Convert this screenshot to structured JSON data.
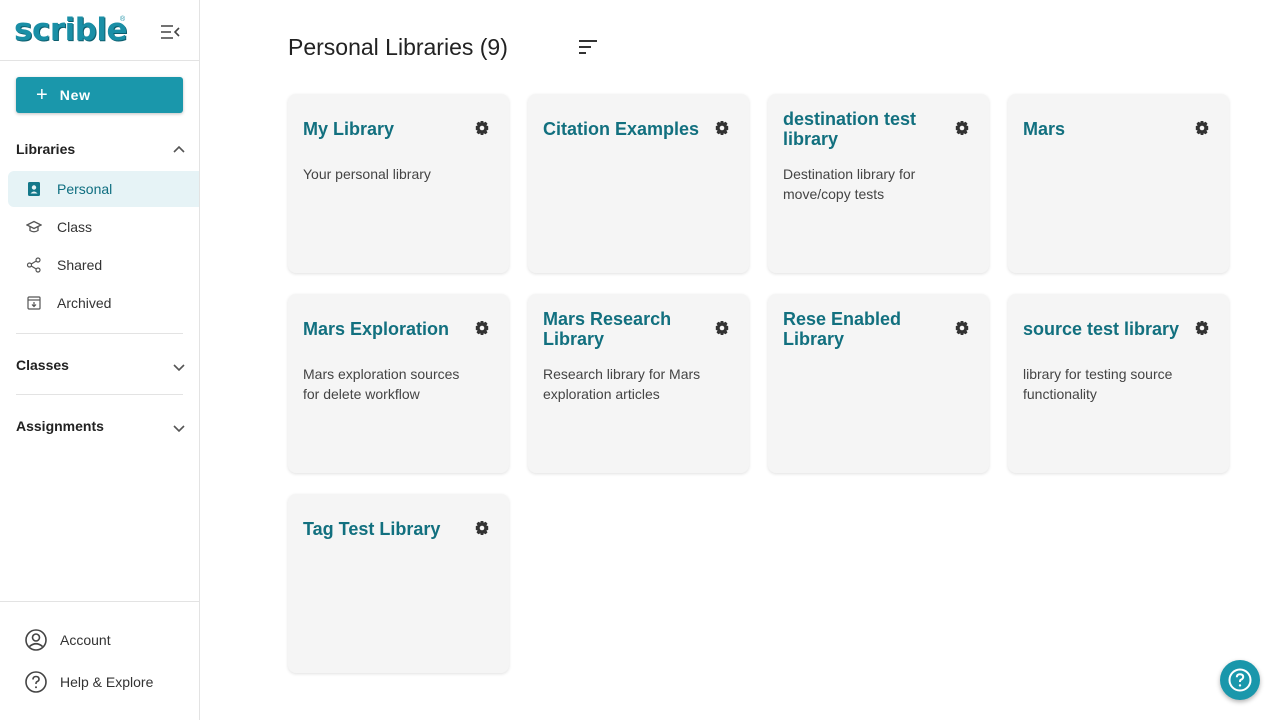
{
  "brand": {
    "name": "scrible",
    "reg": "®"
  },
  "sidebar": {
    "new_label": "New",
    "libraries_title": "Libraries",
    "nav": [
      {
        "label": "Personal",
        "icon": "contact-book-icon",
        "active": true
      },
      {
        "label": "Class",
        "icon": "graduation-cap-icon",
        "active": false
      },
      {
        "label": "Shared",
        "icon": "share-icon",
        "active": false
      },
      {
        "label": "Archived",
        "icon": "archive-icon",
        "active": false
      }
    ],
    "classes_title": "Classes",
    "assignments_title": "Assignments",
    "account_label": "Account",
    "help_label": "Help & Explore"
  },
  "main": {
    "title": "Personal Libraries (9)",
    "cards": [
      {
        "title": "My Library",
        "desc": "Your personal library"
      },
      {
        "title": "Citation Examples",
        "desc": ""
      },
      {
        "title": "destination test library",
        "desc": "Destination library for move/copy tests"
      },
      {
        "title": "Mars",
        "desc": ""
      },
      {
        "title": "Mars Exploration",
        "desc": "Mars exploration sources for delete workflow"
      },
      {
        "title": "Mars Research Library",
        "desc": "Research library for Mars exploration articles"
      },
      {
        "title": "Rese Enabled Library",
        "desc": ""
      },
      {
        "title": "source test library",
        "desc": "library for testing source functionality"
      },
      {
        "title": "Tag Test Library",
        "desc": ""
      }
    ]
  },
  "colors": {
    "accent": "#1a97ab",
    "card_title": "#12707f",
    "active_bg": "#e6f3f6"
  }
}
